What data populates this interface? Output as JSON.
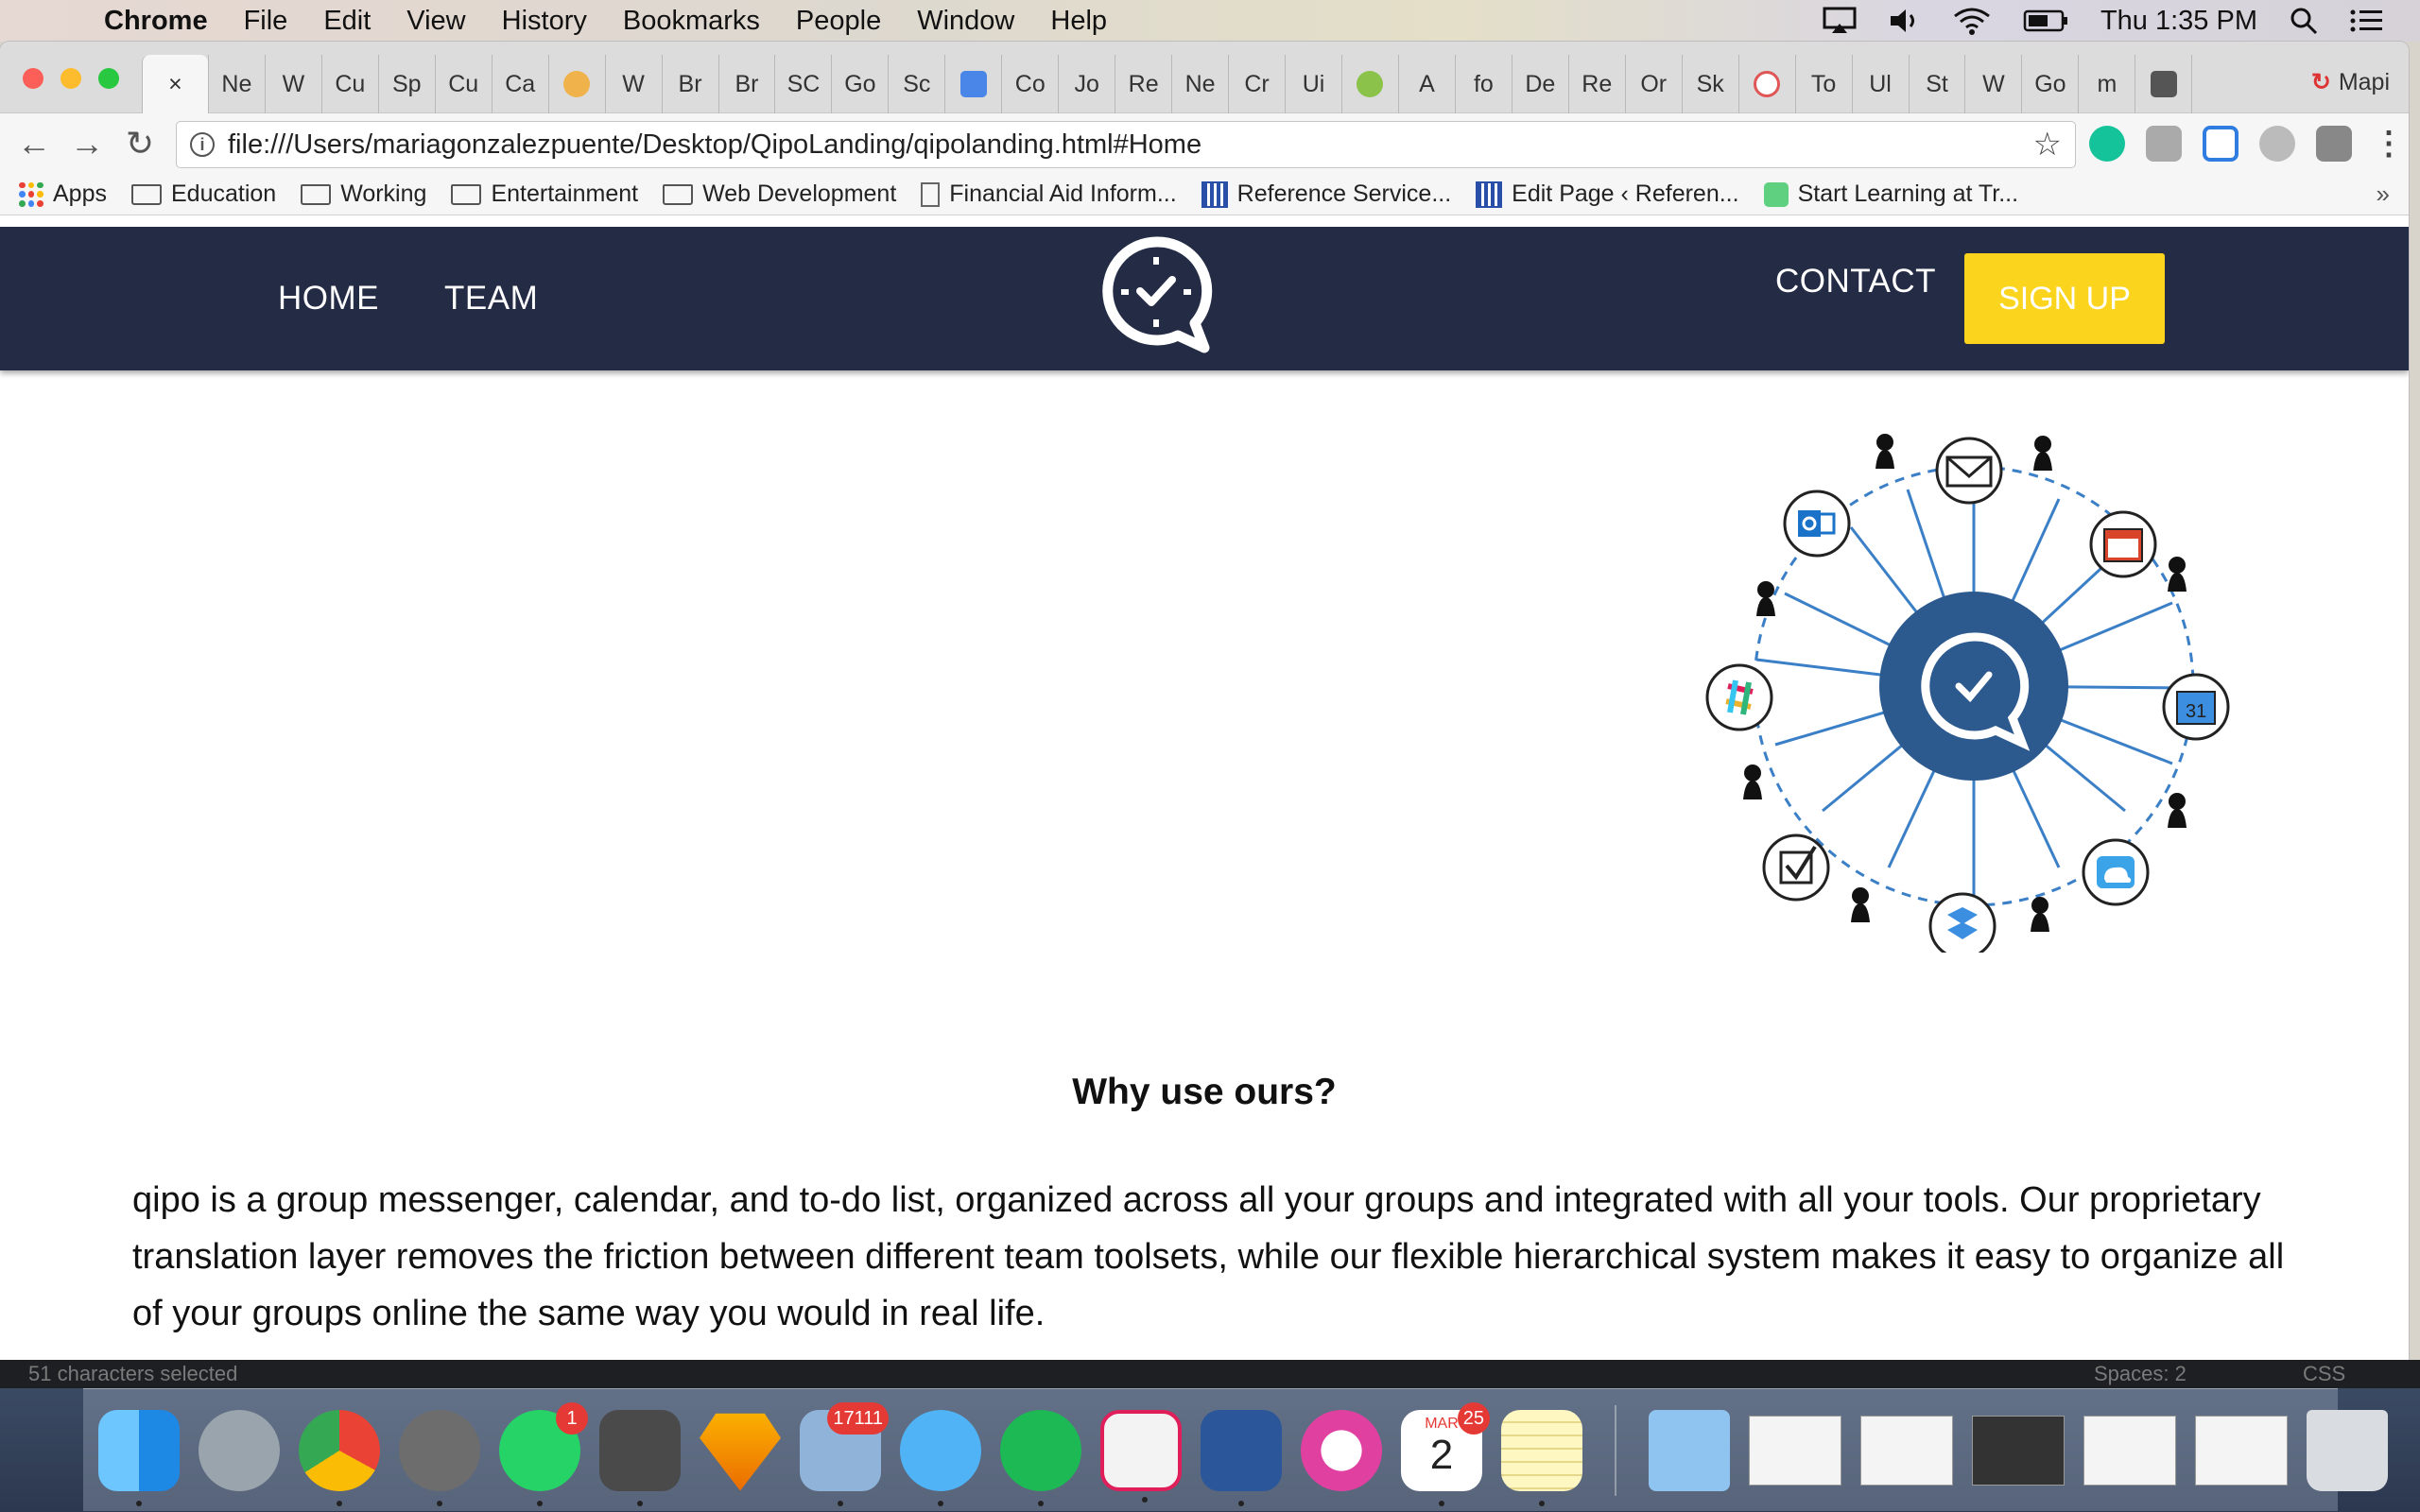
{
  "menubar": {
    "app_name": "Chrome",
    "items": [
      "File",
      "Edit",
      "View",
      "History",
      "Bookmarks",
      "People",
      "Window",
      "Help"
    ],
    "clock": "Thu 1:35 PM"
  },
  "browser": {
    "tabs": [
      "Ne",
      "W",
      "Cu",
      "Sp",
      "Cu",
      "Ca",
      "",
      "W",
      "Br",
      "Br",
      "SC",
      "Go",
      "Sc",
      "",
      "Co",
      "Jo",
      "Re",
      "Ne",
      "Cr",
      "Ui",
      "",
      "A",
      "fo",
      "De",
      "Re",
      "Or",
      "Sk",
      "",
      "To",
      "Ul",
      "St",
      "W",
      "Go",
      "m"
    ],
    "active_tab_close": "×",
    "profile_name": "Mapi",
    "url": "file:///Users/mariagonzalezpuente/Desktop/QipoLanding/qipolanding.html#Home",
    "bookmarks": {
      "apps": "Apps",
      "items": [
        "Education",
        "Working",
        "Entertainment",
        "Web Development",
        "Financial Aid Inform...",
        "Reference Service...",
        "Edit Page ‹ Referen...",
        "Start Learning at Tr..."
      ],
      "more": "»"
    }
  },
  "site": {
    "nav": {
      "home": "HOME",
      "team": "TEAM",
      "contact": "CONTACT",
      "signup": "SIGN UP"
    },
    "why_title": "Why use ours?",
    "why_body": "qipo is a group messenger, calendar, and to-do list, organized across all your groups and integrated with all your tools. Our proprietary translation layer removes the friction between different team toolsets, while our flexible hierarchical system makes it easy to organize all of your groups online the same way you would in real life.",
    "colors": {
      "nav_bg": "#232b45",
      "signup_bg": "#fbd51d",
      "hub_bg": "#2c5a8f"
    },
    "graphic_icons": [
      "email-icon",
      "calendar-icon",
      "google-calendar-icon",
      "icloud-icon",
      "dropbox-icon",
      "todo-icon",
      "slack-icon",
      "outlook-icon"
    ]
  },
  "editor_strip": {
    "selection": "51 characters selected",
    "spaces": "Spaces: 2",
    "syntax": "CSS"
  },
  "dock": {
    "badges": {
      "whatsapp": "1",
      "mail": "17111",
      "calendar": "25"
    },
    "calendar_month": "MAR",
    "calendar_day": "2"
  }
}
